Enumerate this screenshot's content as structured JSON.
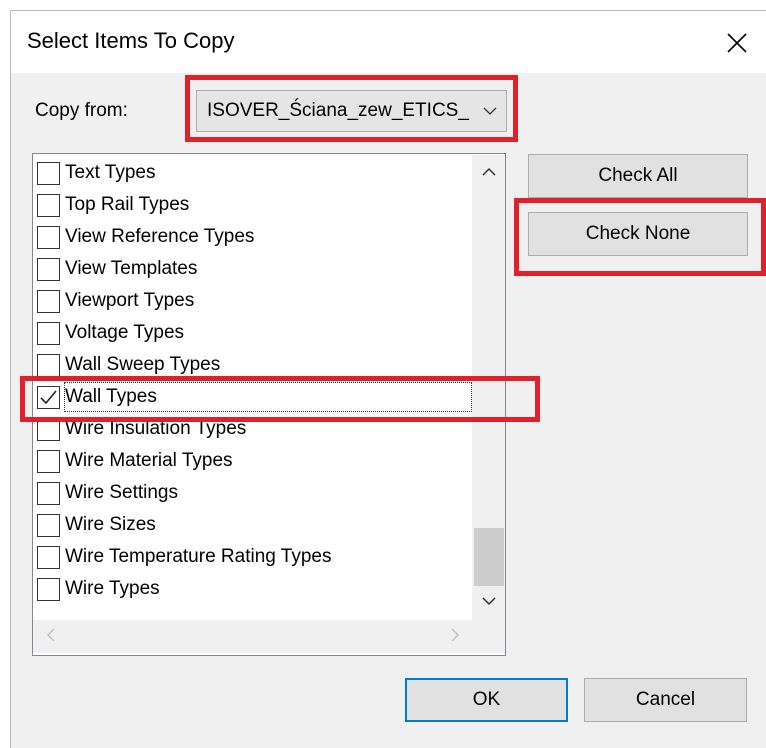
{
  "dialog": {
    "title": "Select Items To Copy",
    "close_glyph": "✕"
  },
  "copy_from": {
    "label": "Copy from:",
    "selected_value": "ISOVER_Ściana_zew_ETICS_"
  },
  "list": {
    "items": [
      {
        "label": "Text Types",
        "checked": false
      },
      {
        "label": "Top Rail Types",
        "checked": false
      },
      {
        "label": "View Reference Types",
        "checked": false
      },
      {
        "label": "View Templates",
        "checked": false
      },
      {
        "label": "Viewport Types",
        "checked": false
      },
      {
        "label": "Voltage Types",
        "checked": false
      },
      {
        "label": "Wall Sweep Types",
        "checked": false
      },
      {
        "label": "Wall Types",
        "checked": true
      },
      {
        "label": "Wire Insulation Types",
        "checked": false
      },
      {
        "label": "Wire Material Types",
        "checked": false
      },
      {
        "label": "Wire Settings",
        "checked": false
      },
      {
        "label": "Wire Sizes",
        "checked": false
      },
      {
        "label": "Wire Temperature Rating Types",
        "checked": false
      },
      {
        "label": "Wire Types",
        "checked": false
      }
    ]
  },
  "buttons": {
    "check_all": "Check All",
    "check_none": "Check None",
    "ok": "OK",
    "cancel": "Cancel"
  },
  "colors": {
    "highlight_red": "#e0202a",
    "default_button_border": "#0078d7"
  }
}
